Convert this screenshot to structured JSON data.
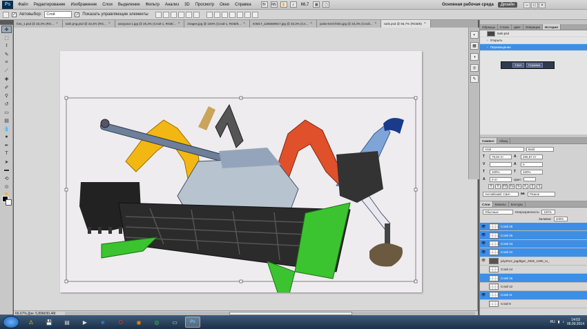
{
  "menu": {
    "items": [
      "Файл",
      "Редактирование",
      "Изображение",
      "Слои",
      "Выделение",
      "Фильтр",
      "Анализ",
      "3D",
      "Просмотр",
      "Окно",
      "Справка"
    ],
    "zoom_label": "66,7",
    "workspace_label": "Основная рабочая среда",
    "design_label": "Дизайн"
  },
  "options": {
    "autoselect_label": "Автовыбор:",
    "autoselect_value": "Слой",
    "show_controls_label": "Показать управляющие элементы"
  },
  "doc_tabs": [
    {
      "label": "foto_1.psd @ 33,3% (RG..."
    },
    {
      "label": "tank.png.psd @ 33,3% (RG..."
    },
    {
      "label": "нагрузка-1.jpg @ 25,3% (Слой 1, RGB/..."
    },
    {
      "label": "images.jpg @ 100% (Слой 1, RGB/8..."
    },
    {
      "label": "IGM17_1185689917.jpg @ 33,3% (Сл..."
    },
    {
      "label": "pulse-kerti-fmks.jpg @ 33,3% (Слой..."
    },
    {
      "label": "tank.psd @ 66,7% (RGB/8)",
      "active": true
    }
  ],
  "status": {
    "zoom": "66,67%",
    "doc_info": "Док: 5,89М/30,4М"
  },
  "history": {
    "tabs": [
      "Образцы",
      "Стили",
      "Цвет",
      "Операции",
      "История"
    ],
    "items": [
      {
        "label": "tank.psd",
        "type": "snapshot"
      },
      {
        "label": "Открыть",
        "type": "step"
      },
      {
        "label": "Перемещение",
        "type": "step",
        "selected": true
      }
    ],
    "float_bar": {
      "country": "США",
      "help": "Справка"
    }
  },
  "character": {
    "tabs": [
      "Символ",
      "Абзац"
    ],
    "font_family": "Arial",
    "font_style": "Bold",
    "font_size": "79,84 пт",
    "leading": "265,97 пт",
    "tracking": "0",
    "kerning": "",
    "vscale": "100%",
    "hscale": "100%",
    "baseline": "0 пт",
    "color_label": "Цвет:",
    "language": "Английский: США",
    "antialias": "Резкое"
  },
  "layers": {
    "tabs": [
      "Слои",
      "Каналы",
      "Контуры"
    ],
    "blend_mode": "Обычные",
    "opacity_label": "Непрозрачность:",
    "opacity_value": "100%",
    "fill_label": "Заливка:",
    "fill_value": "100%",
    "items": [
      {
        "name": "Слой 25",
        "selected": true,
        "visible": true,
        "img": false
      },
      {
        "name": "Слой 26",
        "selected": true,
        "visible": true,
        "img": false
      },
      {
        "name": "Слой 24",
        "selected": true,
        "visible": true,
        "img": false
      },
      {
        "name": "Слой 21",
        "selected": true,
        "visible": true,
        "img": false
      },
      {
        "name": "july2012_jagdtiger_2926_1280_ru_",
        "selected": false,
        "visible": true,
        "img": true
      },
      {
        "name": "Слой 14",
        "selected": false,
        "visible": false,
        "img": false
      },
      {
        "name": "Слой 15",
        "selected": true,
        "visible": false,
        "img": false
      },
      {
        "name": "Слой 12",
        "selected": false,
        "visible": false,
        "img": false
      },
      {
        "name": "Слой 11",
        "selected": true,
        "visible": true,
        "img": false
      },
      {
        "name": "Слой 9",
        "selected": false,
        "visible": false,
        "img": false
      }
    ]
  },
  "taskbar": {
    "lang": "RU",
    "time": "14:03",
    "date": "06.09.2014"
  },
  "colors": {
    "selection_blue": "#3d8fe6",
    "excavator_yellow": "#f2b712",
    "excavator_orange": "#e0502a",
    "excavator_blue": "#7fa4d8",
    "header_green": "#3bc42f"
  }
}
